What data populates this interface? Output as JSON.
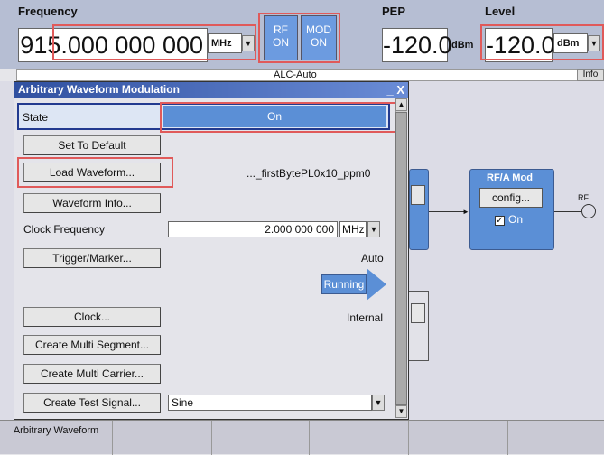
{
  "header": {
    "frequency_label": "Frequency",
    "frequency_value": "915.000 000 000",
    "frequency_unit": "MHz",
    "rf_label": "RF",
    "rf_state": "ON",
    "mod_label": "MOD",
    "mod_state": "ON",
    "pep_label": "PEP",
    "pep_value": "-120.0",
    "pep_unit": "dBm",
    "level_label": "Level",
    "level_value": "-120.0",
    "level_unit": "dBm",
    "alc_text": "ALC-Auto",
    "info_label": "Info"
  },
  "diagram": {
    "rfmod_title": "RF/A Mod",
    "config_label": "config...",
    "on_label": "On",
    "rf_out_label": "RF",
    "check_mark": "✓"
  },
  "dialog": {
    "title": "Arbitrary Waveform Modulation",
    "close_glyph": "_ X",
    "state_label": "State",
    "state_value": "On",
    "set_default_label": "Set To Default",
    "load_waveform_label": "Load Waveform...",
    "loaded_file": "..._firstBytePL0x10_ppm0",
    "waveform_info_label": "Waveform Info...",
    "clock_freq_label": "Clock Frequency",
    "clock_freq_value": "2.000 000 000",
    "clock_freq_unit": "MHz",
    "trigger_marker_label": "Trigger/Marker...",
    "trigger_value": "Auto",
    "running_label": "Running",
    "clock_label": "Clock...",
    "clock_value": "Internal",
    "create_multi_segment_label": "Create Multi Segment...",
    "create_multi_carrier_label": "Create Multi Carrier...",
    "create_test_signal_label": "Create Test Signal...",
    "test_signal_value": "Sine"
  },
  "bottom_menu": {
    "items": [
      "Arbitrary Waveform",
      "",
      "",
      "",
      "",
      ""
    ]
  },
  "colors": {
    "header_bg": "#b6bed3",
    "rf_button": "#6c9be0",
    "highlight_red": "#e05a5a",
    "dialog_title": "#3050a0"
  }
}
